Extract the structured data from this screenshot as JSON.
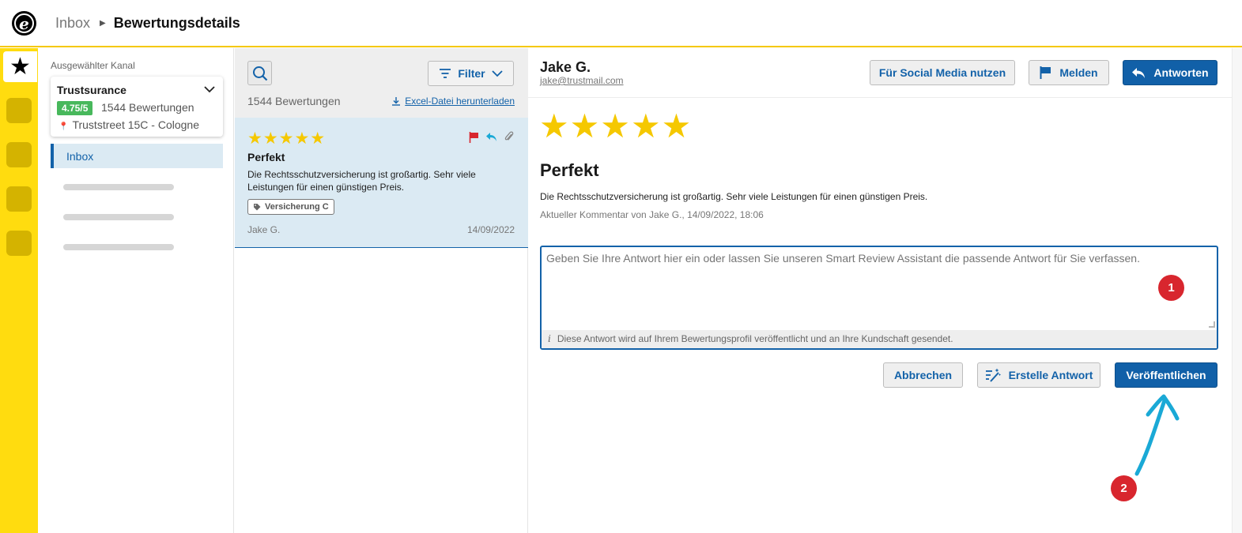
{
  "topbar": {
    "logo_letter": "e",
    "breadcrumb_parent": "Inbox",
    "breadcrumb_current": "Bewertungsdetails"
  },
  "sidebar": {
    "channel_label": "Ausgewählter Kanal",
    "channel_name": "Trustsurance",
    "rating": "4.75/5",
    "review_count": "1544 Bewertungen",
    "address": "Truststreet 15C - Cologne",
    "inbox_label": "Inbox"
  },
  "list": {
    "filter_label": "Filter",
    "total": "1544 Bewertungen",
    "download_label": "Excel-Datei herunterladen",
    "items": [
      {
        "stars": "★★★★★",
        "title": "Perfekt",
        "text": "Die Rechtsschutzversicherung ist großartig. Sehr viele Leistungen für einen günstigen Preis.",
        "tag": "Versicherung C",
        "author": "Jake G.",
        "date": "14/09/2022"
      }
    ]
  },
  "detail": {
    "name": "Jake G.",
    "email": "jake@trustmail.com",
    "social_label": "Für Social Media nutzen",
    "report_label": "Melden",
    "reply_label": "Antworten",
    "stars": "★★★★★",
    "title": "Perfekt",
    "text": "Die Rechtsschutzversicherung ist großartig. Sehr viele Leistungen für einen günstigen Preis.",
    "meta": "Aktueller Kommentar von Jake G., 14/09/2022, 18:06",
    "reply_placeholder": "Geben Sie Ihre Antwort hier ein oder lassen Sie unseren Smart Review Assistant die passende Antwort für Sie verfassen.",
    "reply_hint": "Diese Antwort wird auf Ihrem Bewertungsprofil veröffentlicht und an Ihre Kundschaft gesendet.",
    "cancel_label": "Abbrechen",
    "generate_label": "Erstelle Antwort",
    "publish_label": "Veröffentlichen"
  },
  "annotations": {
    "step1": "1",
    "step2": "2"
  },
  "colors": {
    "brand_yellow": "#ffdc0f",
    "primary_blue": "#1160a8",
    "star_yellow": "#f5c800",
    "rating_green": "#48b85c",
    "badge_red": "#d8262e",
    "arrow_cyan": "#1aa9d6"
  }
}
